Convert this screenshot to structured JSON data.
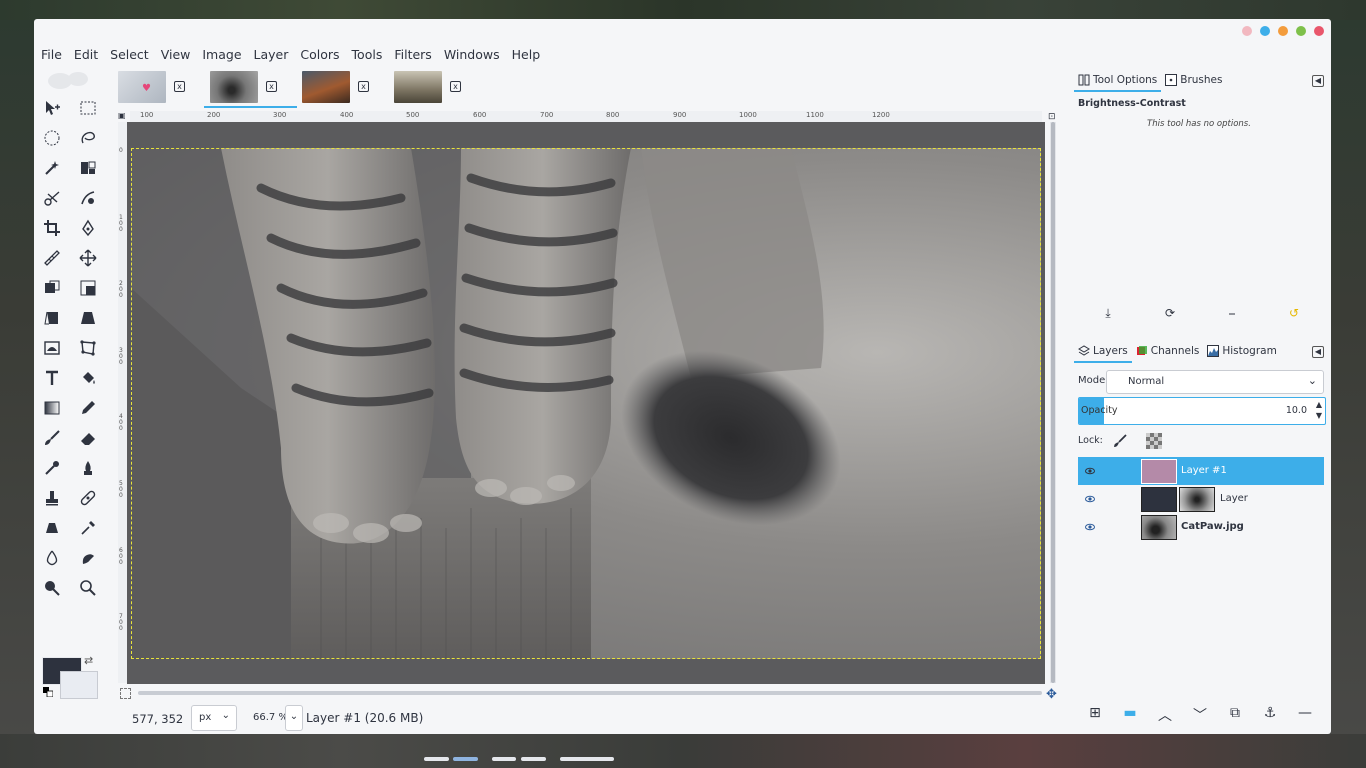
{
  "menu": [
    "File",
    "Edit",
    "Select",
    "View",
    "Image",
    "Layer",
    "Colors",
    "Tools",
    "Filters",
    "Windows",
    "Help"
  ],
  "window_buttons_colors": [
    "#f2b8c0",
    "#3daee9",
    "#f39c3c",
    "#7ec04a",
    "#e9566b"
  ],
  "image_tabs": [
    {
      "name": "image-tab-1",
      "close": "x"
    },
    {
      "name": "image-tab-2",
      "close": "x",
      "active": true
    },
    {
      "name": "image-tab-3",
      "close": "x"
    },
    {
      "name": "image-tab-4",
      "close": "x"
    }
  ],
  "ruler_h": [
    "100",
    "200",
    "300",
    "400",
    "500",
    "600",
    "700",
    "800",
    "900",
    "1000",
    "1100",
    "1200"
  ],
  "ruler_v": [
    "0",
    "100",
    "200",
    "300",
    "400",
    "500",
    "600",
    "700"
  ],
  "statusbar": {
    "coords": "577, 352",
    "unit": "px",
    "zoom": "66.7 %",
    "message": "Layer #1 (20.6 MB)"
  },
  "tool_options": {
    "tab1": "Tool Options",
    "tab2": "Brushes",
    "title": "Brightness-Contrast",
    "note": "This tool has no options."
  },
  "layers_panel": {
    "tab1": "Layers",
    "tab2": "Channels",
    "tab3": "Histogram",
    "mode_label": "Mode:",
    "mode_value": "Normal",
    "opacity_label": "Opacity",
    "opacity_value": "10.0",
    "opacity_fraction": 0.1,
    "lock_label": "Lock:",
    "layers": [
      {
        "name": "Layer #1",
        "bold": false,
        "selected": true,
        "thumb_color": "#b48aa8"
      },
      {
        "name": "Layer",
        "bold": false,
        "selected": false,
        "thumb_color": "#2d323e",
        "has_mask": true
      },
      {
        "name": "CatPaw.jpg",
        "bold": true,
        "selected": false,
        "thumb_color": "#8a8a8a"
      }
    ]
  },
  "colors": {
    "accent": "#3daee9",
    "foreground": "#2d323e",
    "background": "#e9ecf2",
    "canvas": "#5b5b5d"
  }
}
